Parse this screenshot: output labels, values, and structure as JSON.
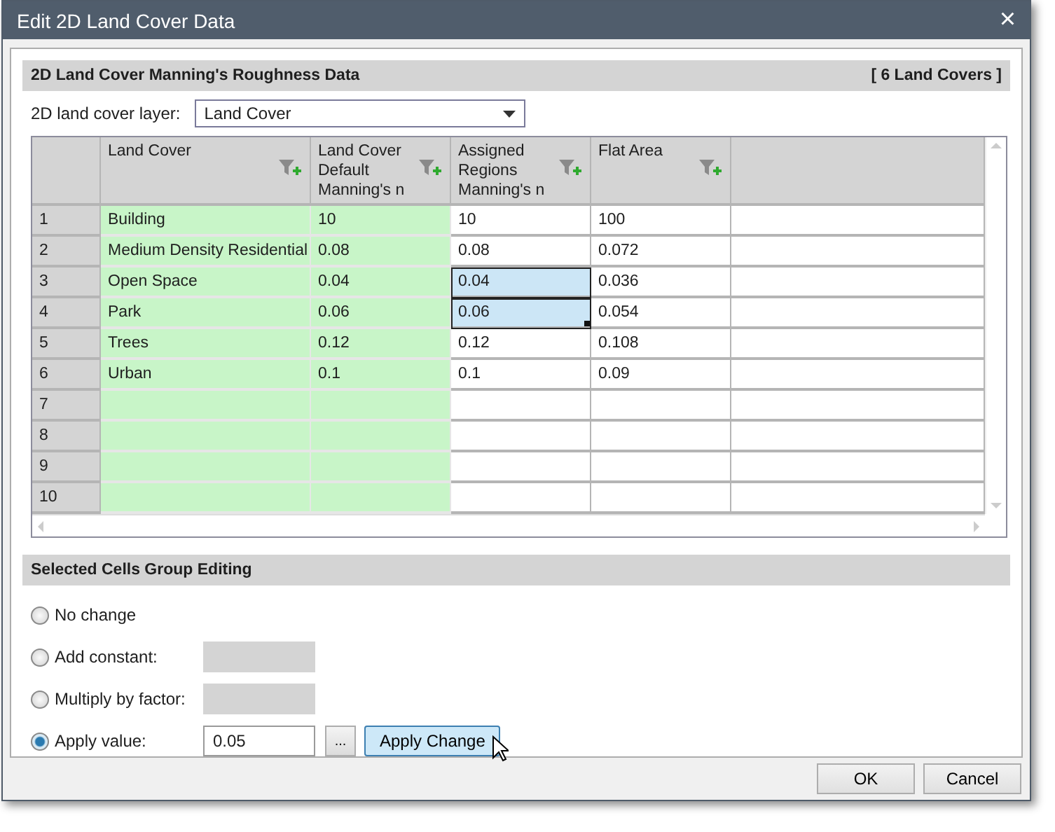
{
  "window": {
    "title": "Edit 2D Land Cover Data",
    "close": "×"
  },
  "data_section": {
    "title": "2D Land Cover Manning's Roughness Data",
    "count": "[ 6 Land Covers ]"
  },
  "layer": {
    "label": "2D land cover layer:",
    "value": "Land Cover"
  },
  "table": {
    "columns": [
      {
        "label": "Land Cover",
        "readonly": true,
        "filter": true
      },
      {
        "label": "Land Cover Default Manning's n",
        "readonly": true,
        "filter": true
      },
      {
        "label": "Assigned Regions Manning's n",
        "readonly": false,
        "filter": true
      },
      {
        "label": "Flat Area",
        "readonly": false,
        "filter": true
      }
    ],
    "rows": [
      {
        "number": "1",
        "cells": [
          "Building",
          "10",
          "10",
          "100"
        ],
        "selected": false
      },
      {
        "number": "2",
        "cells": [
          "Medium Density Residential",
          "0.08",
          "0.08",
          "0.072"
        ],
        "selected": false
      },
      {
        "number": "3",
        "cells": [
          "Open Space",
          "0.04",
          "0.04",
          "0.036"
        ],
        "selected": true
      },
      {
        "number": "4",
        "cells": [
          "Park",
          "0.06",
          "0.06",
          "0.054"
        ],
        "selected": true
      },
      {
        "number": "5",
        "cells": [
          "Trees",
          "0.12",
          "0.12",
          "0.108"
        ],
        "selected": false
      },
      {
        "number": "6",
        "cells": [
          "Urban",
          "0.1",
          "0.1",
          "0.09"
        ],
        "selected": false
      },
      {
        "number": "7",
        "selected": false
      },
      {
        "number": "8",
        "selected": false
      },
      {
        "number": "9",
        "selected": false
      },
      {
        "number": "10",
        "selected": false
      }
    ]
  },
  "group_section": {
    "title": "Selected Cells Group Editing"
  },
  "options": [
    {
      "kind": "plain",
      "label": "No change",
      "selected": false
    },
    {
      "kind": "field",
      "label": "Add constant:",
      "selected": false,
      "disabled": true
    },
    {
      "kind": "field",
      "label": "Multiply by factor:",
      "selected": false,
      "disabled": true
    },
    {
      "kind": "apply",
      "label": "Apply value:",
      "selected": true,
      "disabled": false,
      "value": "0.05",
      "browse": "...",
      "apply": "Apply Change"
    }
  ],
  "buttons": [
    "OK",
    "Cancel"
  ]
}
